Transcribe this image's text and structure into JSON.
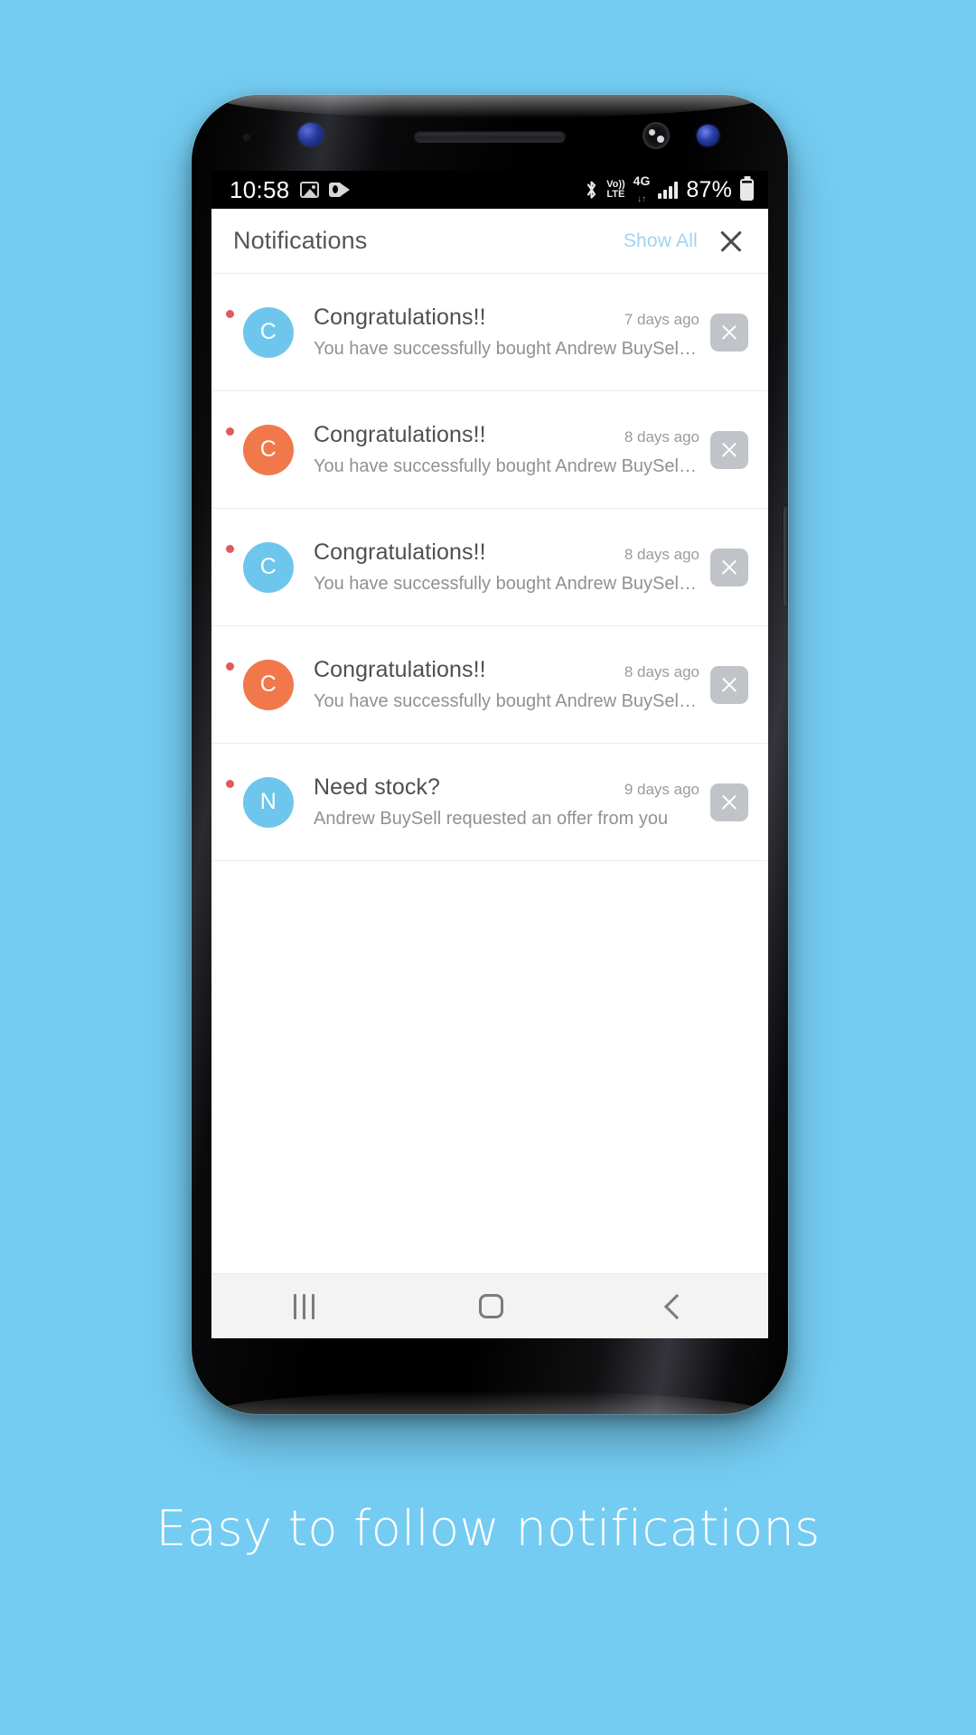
{
  "background_color": "#74CCF2",
  "caption": "Easy to follow notifications",
  "status_bar": {
    "time": "10:58",
    "left_icons": [
      "gallery-icon",
      "outlook-icon"
    ],
    "bluetooth_icon": "bluetooth-icon",
    "volte_line1": "Vo))",
    "volte_line2": "LTE",
    "network_type": "4G",
    "data_arrows": "↓↑",
    "signal_icon": "signal-bars-icon",
    "battery_percent": "87%",
    "battery_icon": "battery-icon"
  },
  "header": {
    "title": "Notifications",
    "show_all_label": "Show All",
    "show_all_color": "#9FD4EE",
    "close_icon": "close-icon"
  },
  "notifications": [
    {
      "avatar_letter": "C",
      "avatar_color": "#6EC6EC",
      "title": "Congratulations!!",
      "time": "7 days ago",
      "text": "You have successfully bought Andrew BuySell st…",
      "unread": true
    },
    {
      "avatar_letter": "C",
      "avatar_color": "#F0784A",
      "title": "Congratulations!!",
      "time": "8 days ago",
      "text": "You have successfully bought Andrew BuySell st…",
      "unread": true
    },
    {
      "avatar_letter": "C",
      "avatar_color": "#6EC6EC",
      "title": "Congratulations!!",
      "time": "8 days ago",
      "text": "You have successfully bought Andrew BuySell st…",
      "unread": true
    },
    {
      "avatar_letter": "C",
      "avatar_color": "#F0784A",
      "title": "Congratulations!!",
      "time": "8 days ago",
      "text": "You have successfully bought Andrew BuySell st…",
      "unread": true
    },
    {
      "avatar_letter": "N",
      "avatar_color": "#6EC6EC",
      "title": "Need stock?",
      "time": "9 days ago",
      "text": "Andrew BuySell requested an offer from you",
      "unread": true
    }
  ],
  "nav_bar": {
    "recents_icon": "recents-icon",
    "home_icon": "home-icon",
    "back_icon": "back-icon"
  }
}
